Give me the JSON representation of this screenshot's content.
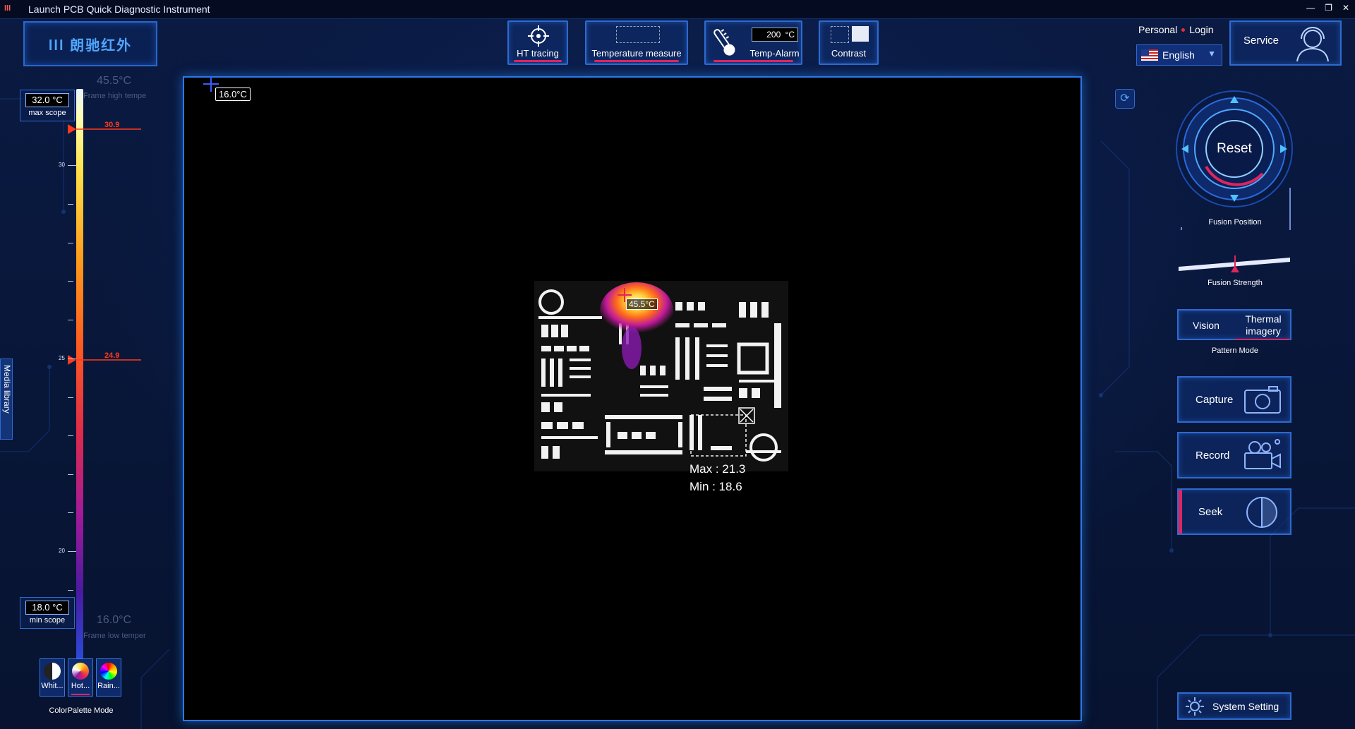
{
  "window": {
    "title": "Launch PCB Quick Diagnostic Instrument",
    "logo_text": "lll",
    "controls": [
      "—",
      "❐",
      "✕"
    ]
  },
  "brand": {
    "text": "lll 朗驰红外"
  },
  "toolbar": {
    "ht_tracing": "HT tracing",
    "temperature_measure": "Temperature measure",
    "temp_alarm": "Temp-Alarm",
    "temp_alarm_value": "200",
    "temp_alarm_unit": "°C",
    "contrast": "Contrast"
  },
  "account": {
    "personal": "Personal",
    "login": "Login",
    "language": "English"
  },
  "service": {
    "label": "Service"
  },
  "scale": {
    "max_value": "32.0 °C",
    "max_label": "max scope",
    "min_value": "18.0 °C",
    "min_label": "min scope",
    "frame_high": "45.5°C",
    "frame_high_label": "Frame high tempe",
    "frame_low": "16.0°C",
    "frame_low_label": "Frame low temper",
    "marker_high": "30.9",
    "marker_low": "24.9",
    "ticks": [
      "30",
      "25",
      "20"
    ]
  },
  "media_library": "Media library",
  "palette": {
    "title": "ColorPalette Mode",
    "items": [
      "Whit...",
      "Hot...",
      "Rain..."
    ]
  },
  "image": {
    "crosshair_temp": "16.0°C",
    "hotspot_temp": "45.5°C",
    "roi_max": "Max : 21.3",
    "roi_min": "Min : 18.6"
  },
  "right_panel": {
    "reset": "Reset",
    "fusion_position": "Fusion Position",
    "fusion_strength": "Fusion Strength",
    "fusion_strength_level": 0.5,
    "pattern_vision": "Vision",
    "pattern_thermal": "Thermal imagery",
    "pattern_mode": "Pattern Mode",
    "capture": "Capture",
    "record": "Record",
    "seek": "Seek",
    "system_setting": "System Setting"
  },
  "colors": {
    "accent": "#2e6ad0",
    "alarm": "#e0245e",
    "marker": "#ff3a1a"
  }
}
